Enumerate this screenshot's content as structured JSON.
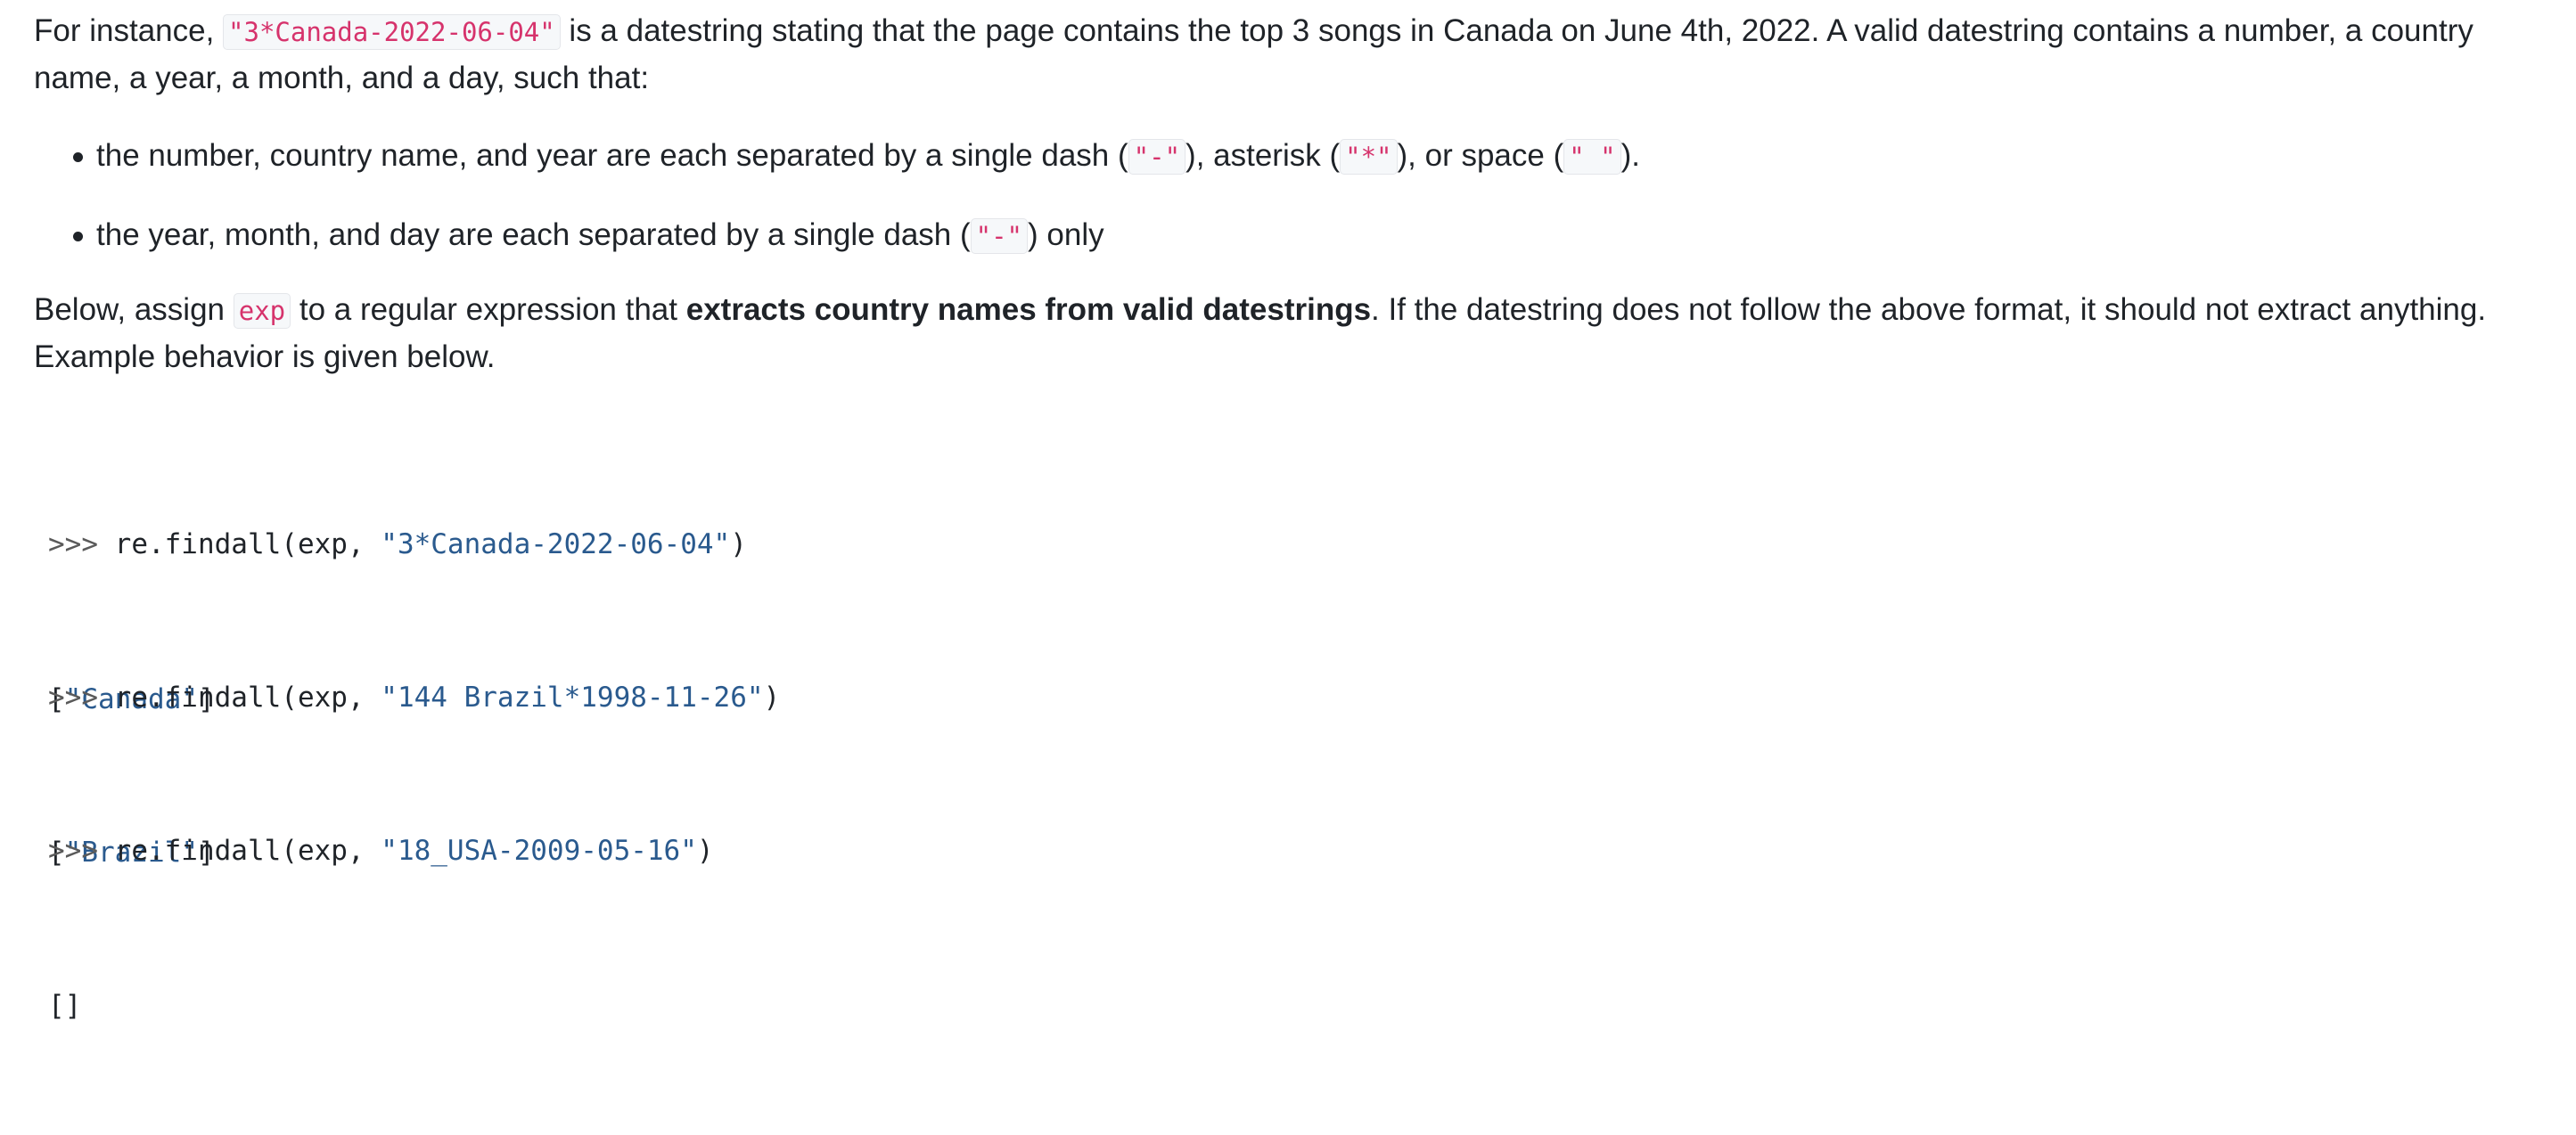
{
  "paragraph1": {
    "text_a": "For instance, ",
    "code_a": "\"3*Canada-2022-06-04\"",
    "text_b": " is a datestring stating that the page contains the top 3 songs in Canada on June 4th, 2022. A valid datestring contains a number, a country name, a year, a month, and a day, such that:"
  },
  "bullets": [
    {
      "text_a": "the number, country name, and year are each separated by a single dash (",
      "code_a": "\"-\"",
      "text_b": "), asterisk (",
      "code_b": "\"*\"",
      "text_c": "), or space (",
      "code_c": "\" \"",
      "text_d": ")."
    },
    {
      "text_a": "the year, month, and day are each separated by a single dash (",
      "code_a": "\"-\"",
      "text_b": ") only"
    }
  ],
  "paragraph2": {
    "text_a": "Below, assign ",
    "code_a": "exp",
    "text_b": " to a regular expression that ",
    "bold": "extracts country names from valid datestrings",
    "text_c": ". If the datestring does not follow the above format, it should not extract anything. Example behavior is given below."
  },
  "examples": [
    {
      "prompt": ">>> ",
      "call_prefix": "re.findall(exp, ",
      "arg": "\"3*Canada-2022-06-04\"",
      "call_suffix": ")",
      "output_open": "[",
      "output_value": "\"Canada\"",
      "output_close": "]"
    },
    {
      "prompt": ">>> ",
      "call_prefix": "re.findall(exp, ",
      "arg": "\"144 Brazil*1998-11-26\"",
      "call_suffix": ")",
      "output_open": "[",
      "output_value": "\"Brazil\"",
      "output_close": "]"
    },
    {
      "prompt": ">>> ",
      "call_prefix": "re.findall(exp, ",
      "arg": "\"18_USA-2009-05-16\"",
      "call_suffix": ")",
      "output_open": "[]",
      "output_value": "",
      "output_close": ""
    }
  ]
}
